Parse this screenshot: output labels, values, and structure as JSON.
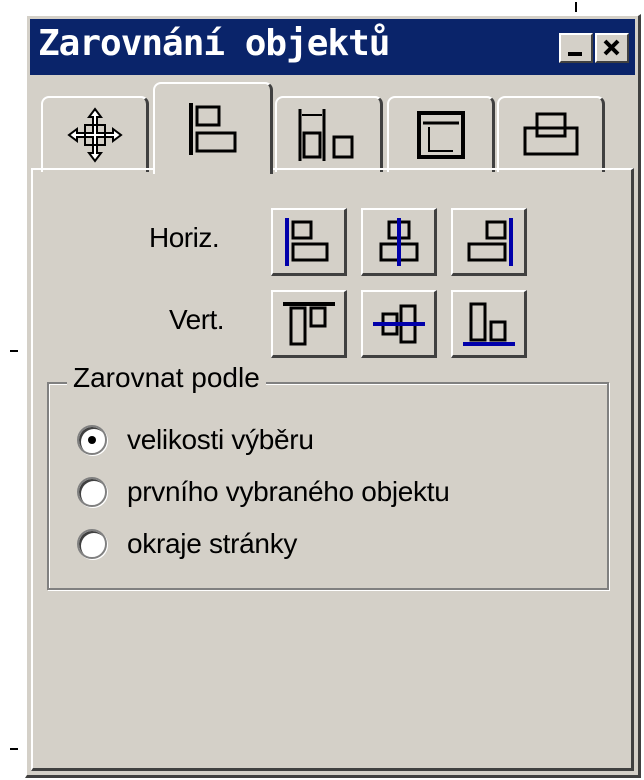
{
  "window": {
    "title": "Zarovnání objektů"
  },
  "titlebar_buttons": {
    "minimize": "minimize-icon",
    "close": "close-icon"
  },
  "tabs": [
    {
      "icon": "move-icon",
      "active": false
    },
    {
      "icon": "align-icon",
      "active": true
    },
    {
      "icon": "distribute-icon",
      "active": false
    },
    {
      "icon": "size-icon",
      "active": false
    },
    {
      "icon": "arrange-icon",
      "active": false
    }
  ],
  "align": {
    "horiz_label": "Horiz.",
    "vert_label": "Vert.",
    "horiz_buttons": [
      "align-left-icon",
      "align-center-horizontal-icon",
      "align-right-icon"
    ],
    "vert_buttons": [
      "align-top-icon",
      "align-middle-vertical-icon",
      "align-bottom-icon"
    ]
  },
  "align_by": {
    "legend": "Zarovnat podle",
    "options": [
      {
        "label": "velikosti výběru",
        "checked": true
      },
      {
        "label": "prvního vybraného objektu",
        "checked": false
      },
      {
        "label": "okraje stránky",
        "checked": false
      }
    ]
  },
  "colors": {
    "titlebar": "#0a246a",
    "face": "#d4d0c8",
    "accent_line": "#0000aa"
  }
}
